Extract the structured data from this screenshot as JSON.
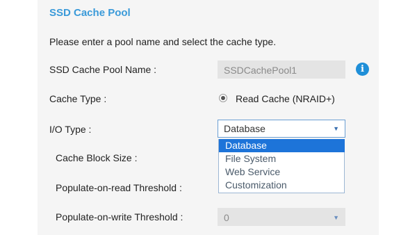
{
  "title": "SSD Cache Pool",
  "instruction": "Please enter a pool name and select the cache type.",
  "pool_name": {
    "label": "SSD Cache Pool Name :",
    "value": "SSDCachePool1"
  },
  "cache_type": {
    "label": "Cache Type :",
    "option": "Read Cache (NRAID+)",
    "selected": true
  },
  "io_type": {
    "label": "I/O Type :",
    "value": "Database",
    "options": [
      "Database",
      "File System",
      "Web Service",
      "Customization"
    ],
    "selected_index": 0
  },
  "cache_block_size": {
    "label": "Cache Block Size :"
  },
  "populate_read": {
    "label": "Populate-on-read Threshold :"
  },
  "populate_write": {
    "label": "Populate-on-write Threshold :",
    "value": "0"
  },
  "icons": {
    "info": "info-icon",
    "dropdown_arrow": "chevron-down-icon"
  },
  "colors": {
    "title": "#3a9ad9",
    "selected_option": "#1d74d9",
    "info_icon": "#1f8fd8"
  }
}
